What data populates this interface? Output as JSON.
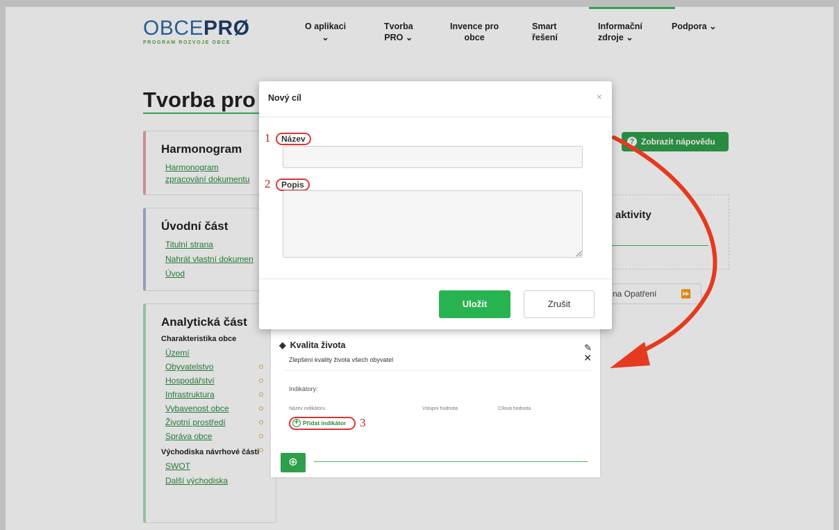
{
  "header": {
    "logo_main": "OBCE",
    "logo_bold": "PRØ",
    "logo_sub": "PROGRAM ROZVOJE OBCE",
    "nav": [
      {
        "line1": "O aplikaci",
        "line2": "⌄"
      },
      {
        "line1": "Tvorba",
        "line2": "PRO ⌄"
      },
      {
        "line1": "Invence pro",
        "line2": "obce"
      },
      {
        "line1": "Smart",
        "line2": "řešení"
      },
      {
        "line1": "Informační",
        "line2": "zdroje ⌄"
      },
      {
        "line1": "Podpora ⌄",
        "line2": ""
      }
    ]
  },
  "page": {
    "title": "Tvorba pro"
  },
  "sidebar": {
    "harmonogram": {
      "title": "Harmonogram",
      "links": [
        "Harmonogram",
        "zpracování dokumentu"
      ]
    },
    "uvod": {
      "title": "Úvodní část",
      "links": [
        "Titulní strana",
        "Nahrát vlastní dokumen",
        "Úvod"
      ]
    },
    "analyticka": {
      "title": "Analytická část",
      "subtitle1": "Charakteristika obce",
      "links": [
        "Území",
        "Obyvatelstvo",
        "Hospodářství",
        "Infrastruktura",
        "Vybavenost obce",
        "Životní prostředí",
        "Správa obce"
      ],
      "subtitle2": "Východiska návrhové části",
      "links2": [
        "SWOT",
        "Další východiska"
      ]
    }
  },
  "background": {
    "help_button": "Zobrazit nápovědu",
    "help_icon": "?",
    "activity_title": "aktivity",
    "opatreni_button": "na Opatření",
    "opatreni_arrow": "⏩"
  },
  "goal_panel": {
    "icon": "◈",
    "title": "Kvalita života",
    "description": "Zlepšení kvality života všech obyvatel",
    "indicators_label": "Indikátory:",
    "columns": [
      "Název indikátoru",
      "Vstupní hodnota",
      "Cílová hodnota"
    ],
    "add_indicator": "Přidat indikátor",
    "add_indicator_number": "3",
    "add_button": "⊕"
  },
  "modal": {
    "title": "Nový cíl",
    "close": "×",
    "name_label": "Název",
    "name_number": "1",
    "name_value": "",
    "desc_label": "Popis",
    "desc_number": "2",
    "desc_value": "",
    "save_button": "Uložit",
    "cancel_button": "Zrušit"
  },
  "colors": {
    "accent_green": "#2e9f4a",
    "annotation_red": "#e53a1f"
  }
}
